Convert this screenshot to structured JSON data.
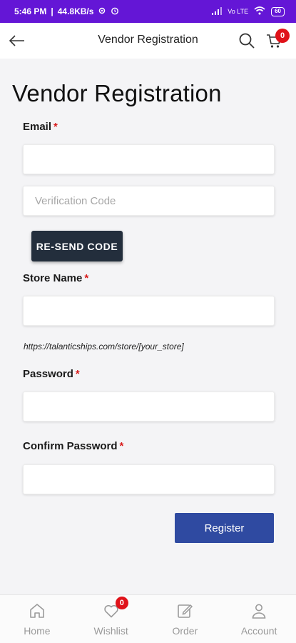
{
  "status_bar": {
    "time": "5:46 PM",
    "speed": "44.8KB/s",
    "battery": "60",
    "network_label": "Vo LTE"
  },
  "header": {
    "title": "Vendor Registration",
    "cart_count": "0"
  },
  "page": {
    "title": "Vendor Registration"
  },
  "form": {
    "email_label": "Email",
    "email_value": "",
    "verification_placeholder": "Verification Code",
    "resend_label": "RE-SEND CODE",
    "store_name_label": "Store Name",
    "store_name_value": "",
    "store_url_hint": "https://talanticships.com/store/[your_store]",
    "password_label": "Password",
    "password_value": "",
    "confirm_password_label": "Confirm Password",
    "confirm_password_value": "",
    "required_mark": "*",
    "register_label": "Register"
  },
  "bottom_nav": {
    "items": [
      {
        "label": "Home",
        "icon": "home-icon"
      },
      {
        "label": "Wishlist",
        "icon": "heart-icon",
        "badge": "0"
      },
      {
        "label": "Order",
        "icon": "edit-icon"
      },
      {
        "label": "Account",
        "icon": "user-icon"
      }
    ]
  },
  "colors": {
    "status_bar": "#6416d6",
    "primary_button": "#2f4aa1",
    "dark_button": "#232e3c",
    "badge": "#e01219",
    "required": "#d81b1b"
  }
}
